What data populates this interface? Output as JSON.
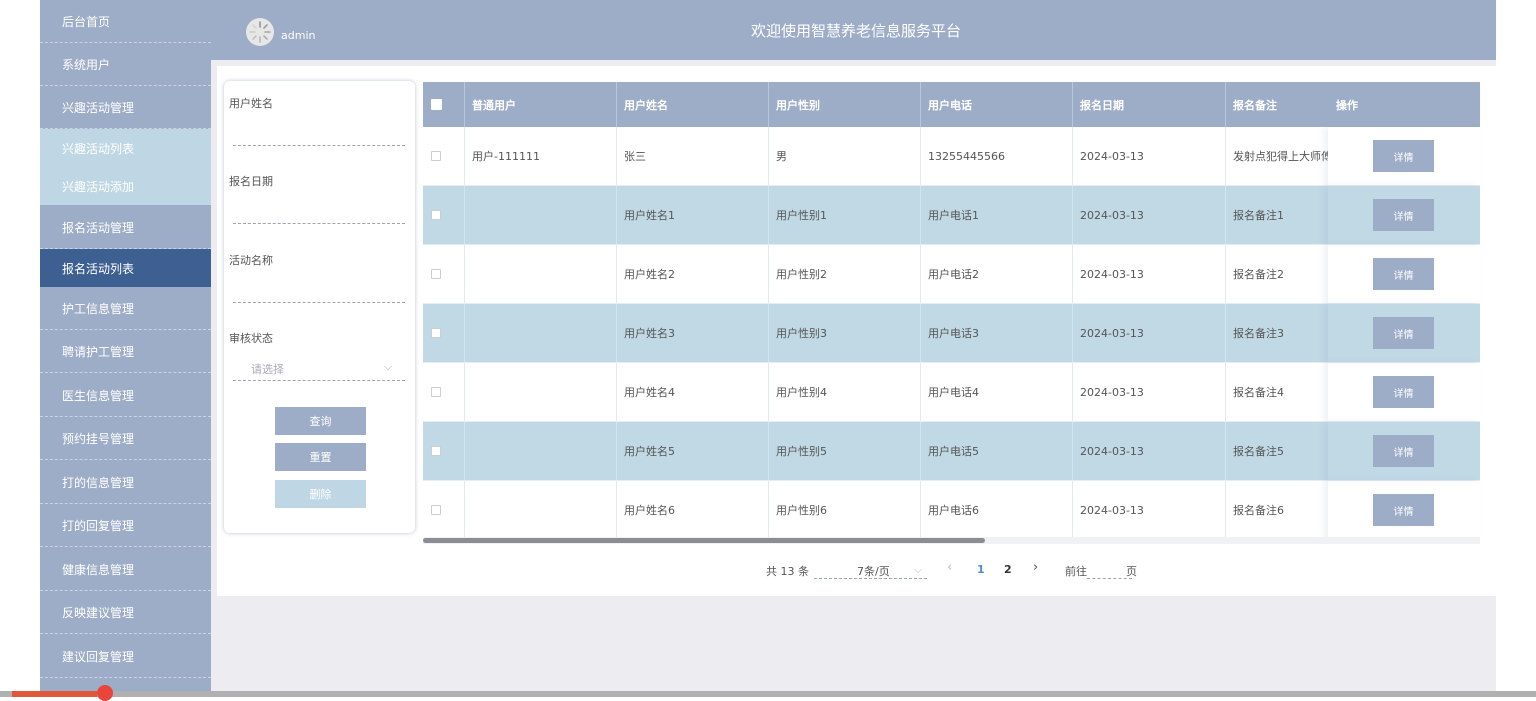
{
  "header": {
    "admin_name": "admin",
    "title": "欢迎使用智慧养老信息服务平台"
  },
  "sidebar": {
    "items": [
      {
        "label": "后台首页"
      },
      {
        "label": "系统用户"
      },
      {
        "label": "兴趣活动管理"
      },
      {
        "label": "兴趣活动列表"
      },
      {
        "label": "兴趣活动添加"
      },
      {
        "label": "报名活动管理"
      },
      {
        "label": "报名活动列表"
      },
      {
        "label": "护工信息管理"
      },
      {
        "label": "聘请护工管理"
      },
      {
        "label": "医生信息管理"
      },
      {
        "label": "预约挂号管理"
      },
      {
        "label": "打的信息管理"
      },
      {
        "label": "打的回复管理"
      },
      {
        "label": "健康信息管理"
      },
      {
        "label": "反映建议管理"
      },
      {
        "label": "建议回复管理"
      }
    ]
  },
  "search": {
    "user_name_label": "用户姓名",
    "signup_date_label": "报名日期",
    "activity_name_label": "活动名称",
    "review_status_label": "审核状态",
    "review_status_placeholder": "请选择",
    "query_label": "查询",
    "reset_label": "重置",
    "delete_label": "删除"
  },
  "table": {
    "headers": [
      "普通用户",
      "用户姓名",
      "用户性别",
      "用户电话",
      "报名日期",
      "报名备注",
      "操作"
    ],
    "rows": [
      {
        "user": "用户-111111",
        "name": "张三",
        "gender": "男",
        "phone": "13255445566",
        "date": "2024-03-13",
        "note": "发射点犯得上大师傅",
        "action": "详情"
      },
      {
        "user": "",
        "name": "用户姓名1",
        "gender": "用户性别1",
        "phone": "用户电话1",
        "date": "2024-03-13",
        "note": "报名备注1",
        "action": "详情"
      },
      {
        "user": "",
        "name": "用户姓名2",
        "gender": "用户性别2",
        "phone": "用户电话2",
        "date": "2024-03-13",
        "note": "报名备注2",
        "action": "详情"
      },
      {
        "user": "",
        "name": "用户姓名3",
        "gender": "用户性别3",
        "phone": "用户电话3",
        "date": "2024-03-13",
        "note": "报名备注3",
        "action": "详情"
      },
      {
        "user": "",
        "name": "用户姓名4",
        "gender": "用户性别4",
        "phone": "用户电话4",
        "date": "2024-03-13",
        "note": "报名备注4",
        "action": "详情"
      },
      {
        "user": "",
        "name": "用户姓名5",
        "gender": "用户性别5",
        "phone": "用户电话5",
        "date": "2024-03-13",
        "note": "报名备注5",
        "action": "详情"
      },
      {
        "user": "",
        "name": "用户姓名6",
        "gender": "用户性别6",
        "phone": "用户电话6",
        "date": "2024-03-13",
        "note": "报名备注6",
        "action": "详情"
      }
    ]
  },
  "pagination": {
    "total": "共 13 条",
    "page_size": "7条/页",
    "prev": "‹",
    "page1": "1",
    "page2": "2",
    "next": "›",
    "goto_prefix": "前往",
    "goto_suffix": "页",
    "current_page": 1
  },
  "colors": {
    "sidebar_bg": "#9dadc7",
    "active_bg": "#3d5f92",
    "row_alt_bg": "#c1d9e5",
    "link": "#4a90d9"
  }
}
